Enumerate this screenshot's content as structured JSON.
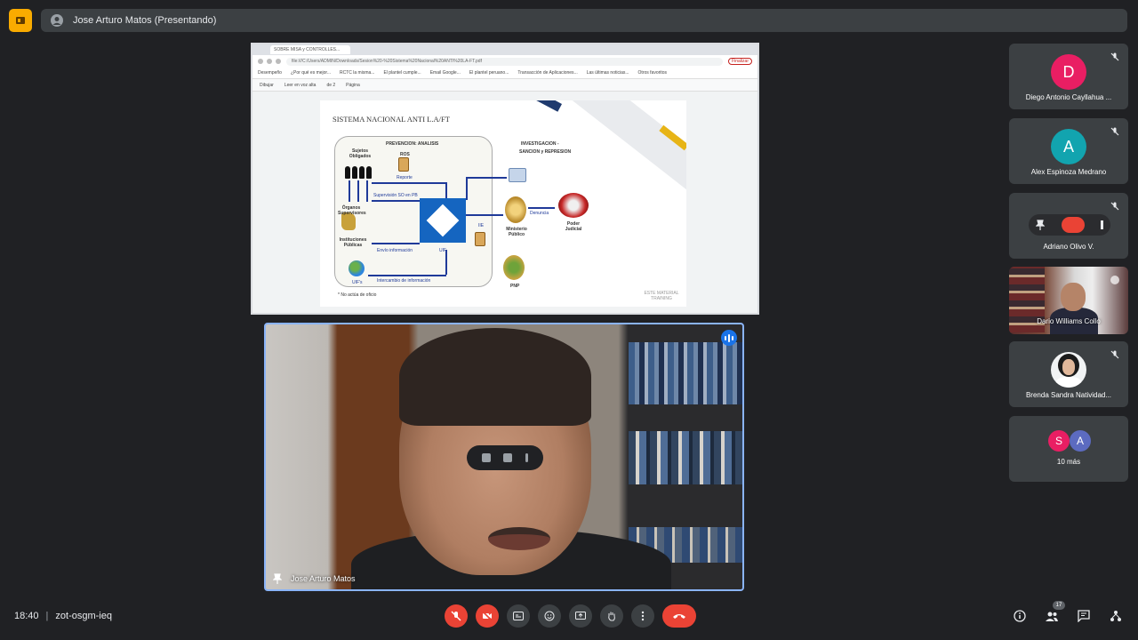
{
  "presenter_bar": {
    "title": "Jose Arturo Matos (Presentando)"
  },
  "browser": {
    "tab_title": "SOBRE MISA y CONTROLLES...",
    "address": "file:///C:/Users/ADMIN/Downloads/Sesion%20-%20Sistema%20Nacional%20ANTI%20LA-FT.pdf",
    "finish_label": "Finalizar",
    "bookmarks": [
      "Desempeño",
      "¿Por qué es mejor...",
      "RCTC la misma...",
      "El plantel cumple...",
      "Email Google...",
      "El plantel peruano...",
      "Transacción de Aplicaciones...",
      "Las últimas noticias...",
      "Otros favoritos"
    ],
    "pdf_toolbar": [
      "Dibujar",
      "Leer en voz alta",
      "de 2",
      "Página"
    ]
  },
  "slide": {
    "title": "SISTEMA NACIONAL ANTI L.A/FT",
    "section_left": "PREVENCION: ANALISIS",
    "section_right_1": "INVESTIGACION -",
    "section_right_2": "SANCION y REPRESION",
    "labels": {
      "sujetos": "Sujetos Obligados",
      "ros": "ROS",
      "reporte": "Reporte",
      "supervision": "Supervisión SO en PB",
      "organos": "Órganos Supervisores",
      "instituciones": "Instituciones Públicas",
      "envio": "Envío información",
      "uif": "UIF",
      "ie": "IIE",
      "denuncia": "Denuncia",
      "ministerio": "Ministerio Público",
      "poder_judicial": "Poder Judicial",
      "pnp": "PNP",
      "uifs": "UIF's",
      "intercambio": "Intercambio de información",
      "footnote": "* No actúa de oficio",
      "credits": "ESTE MATERIAL TRAINING"
    }
  },
  "speaker": {
    "name": "Jose Arturo Matos"
  },
  "participants": [
    {
      "name": "Diego Antonio Cayllahua ...",
      "initial": "D",
      "color": "#e91e63"
    },
    {
      "name": "Alex Espinoza Medrano",
      "initial": "A",
      "color": "#12a4af"
    },
    {
      "name": "Adriano Olivo V.",
      "initial": "",
      "color": "#3c4043"
    },
    {
      "name": "Dario Williams Collo",
      "initial": "",
      "color": ""
    },
    {
      "name": "Brenda Sandra Natividad...",
      "initial": "",
      "color": "#f1f3f4"
    },
    {
      "name": "10 más",
      "initials": [
        "S",
        "A"
      ],
      "colors": [
        "#e91e63",
        "#5c6bc0"
      ]
    }
  ],
  "bottom": {
    "time": "18:40",
    "meeting_code": "zot-osgm-ieq",
    "participant_count": "17",
    "buttons": [
      "mic-off",
      "camera-off",
      "captions",
      "emoji",
      "present",
      "raise-hand",
      "more",
      "leave-call"
    ]
  },
  "colors": {
    "background": "#202124",
    "surface": "#3c4043",
    "danger": "#ea4335",
    "accent": "#8ab4f8",
    "logo": "#f9ab00"
  }
}
